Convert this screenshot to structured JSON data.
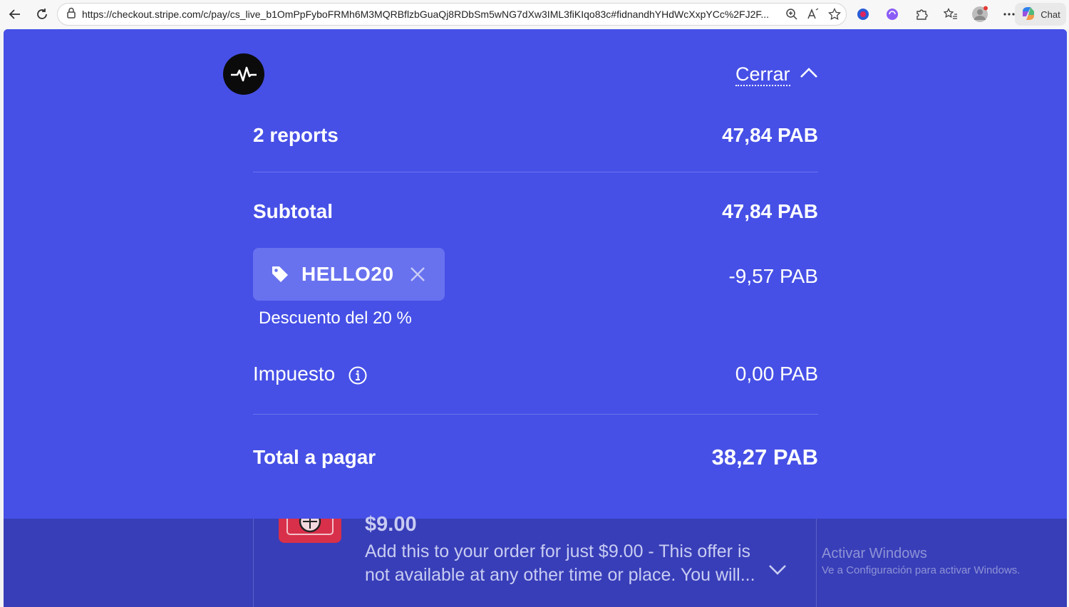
{
  "browser": {
    "url": "https://checkout.stripe.com/c/pay/cs_live_b1OmPpFyboFRMh6M3MQRBflzbGuaQj8RDbSm5wNG7dXw3IML3fiKIqo83c#fidnandhYHdWcXxpYCc%2FJ2F...",
    "chat_label": "Chat"
  },
  "header": {
    "close_label": "Cerrar"
  },
  "summary": {
    "items_label": "2 reports",
    "items_value": "47,84 PAB",
    "subtotal_label": "Subtotal",
    "subtotal_value": "47,84 PAB",
    "coupon_code": "HELLO20",
    "discount_value": "-9,57 PAB",
    "discount_note": "Descuento del 20 %",
    "tax_label": "Impuesto",
    "tax_value": "0,00 PAB",
    "total_label": "Total a pagar",
    "total_value": "38,27 PAB"
  },
  "upsell": {
    "price": "$9.00",
    "description": "Add this to your order for just $9.00 - This offer is not available at any other time or place. You will..."
  },
  "windows_watermark": {
    "title": "Activar Windows",
    "subtitle": "Ve a Configuración para activar Windows."
  }
}
